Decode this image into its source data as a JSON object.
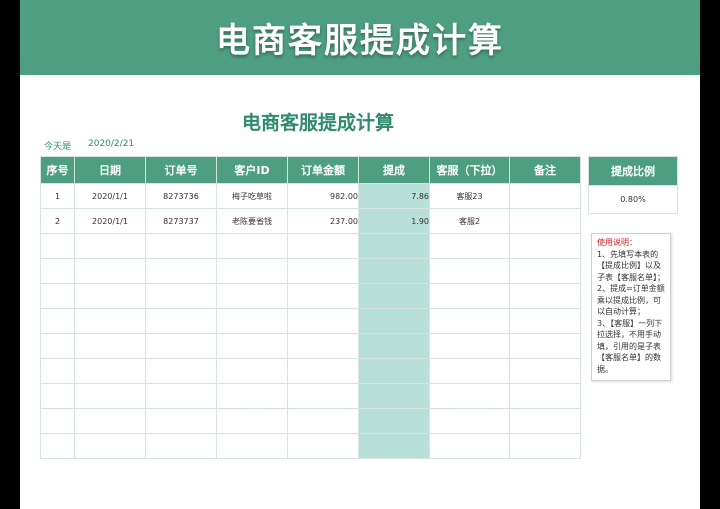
{
  "banner": {
    "title": "电商客服提成计算"
  },
  "sheet": {
    "title": "电商客服提成计算",
    "today_label": "今天是",
    "today_value": "2020/2/21"
  },
  "table": {
    "headers": [
      "序号",
      "日期",
      "订单号",
      "客户ID",
      "订单金额",
      "提成",
      "客服（下拉）",
      "备注"
    ],
    "rows": [
      [
        "1",
        "2020/1/1",
        "8273736",
        "梅子吃草啦",
        "982.00",
        "7.86",
        "客服23",
        ""
      ],
      [
        "2",
        "2020/1/1",
        "8273737",
        "老陈要省钱",
        "237.00",
        "1.90",
        "客服2",
        ""
      ]
    ]
  },
  "ratio": {
    "header": "提成比例",
    "value": "0.80%"
  },
  "notes": {
    "title": "使用说明：",
    "body": "1、先填写本表的【提成比例】以及子表【客服名单】；\n2、提成=订单金额乘以提成比例，可以自动计算；\n3、【客服】一列下拉选择，不用手动填，引用的是子表【客服名单】的数据。"
  },
  "colors": {
    "header_green": "#4e9e82",
    "title_green": "#2f8a6e",
    "commission_fill": "#b9e0d8",
    "note_red": "#d0202a"
  }
}
